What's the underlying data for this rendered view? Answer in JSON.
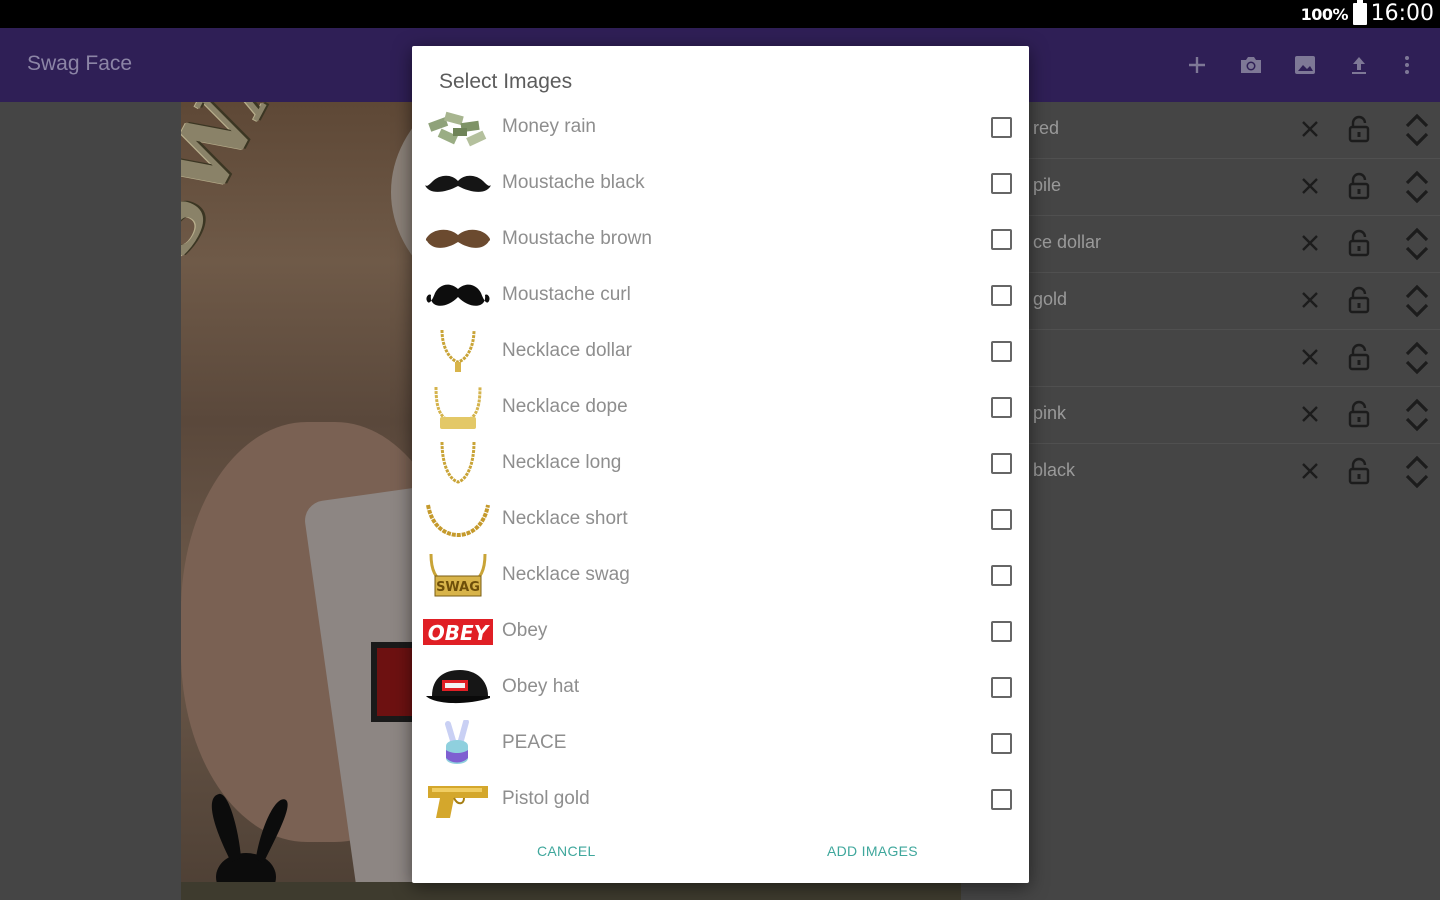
{
  "status_bar": {
    "battery": "100%",
    "time": "16:00"
  },
  "toolbar": {
    "title": "Swag Face",
    "actions": [
      {
        "name": "add-icon"
      },
      {
        "name": "camera-icon"
      },
      {
        "name": "image-icon"
      },
      {
        "name": "upload-icon"
      },
      {
        "name": "more-vert-icon"
      }
    ]
  },
  "photo": {
    "overlay_text": "SWAG"
  },
  "layers": [
    {
      "label": "red"
    },
    {
      "label": "pile"
    },
    {
      "label": "ce dollar"
    },
    {
      "label": "gold"
    },
    {
      "label": ""
    },
    {
      "label": "pink"
    },
    {
      "label": "black"
    }
  ],
  "dialog": {
    "title": "Select Images",
    "items": [
      {
        "label": "Money rain",
        "checked": false
      },
      {
        "label": "Moustache black",
        "checked": false
      },
      {
        "label": "Moustache brown",
        "checked": false
      },
      {
        "label": "Moustache curl",
        "checked": false
      },
      {
        "label": "Necklace dollar",
        "checked": false
      },
      {
        "label": "Necklace dope",
        "checked": false
      },
      {
        "label": "Necklace long",
        "checked": false
      },
      {
        "label": "Necklace short",
        "checked": false
      },
      {
        "label": "Necklace swag",
        "checked": false
      },
      {
        "label": "Obey",
        "checked": false
      },
      {
        "label": "Obey hat",
        "checked": false
      },
      {
        "label": "PEACE",
        "checked": false
      },
      {
        "label": "Pistol gold",
        "checked": false
      }
    ],
    "thumb_text": {
      "obey": "OBEY",
      "swag": "SWAG"
    },
    "cancel_label": "CANCEL",
    "add_label": "ADD IMAGES"
  },
  "colors": {
    "toolbar": "#2f1f56",
    "accent": "#3fa79c"
  }
}
